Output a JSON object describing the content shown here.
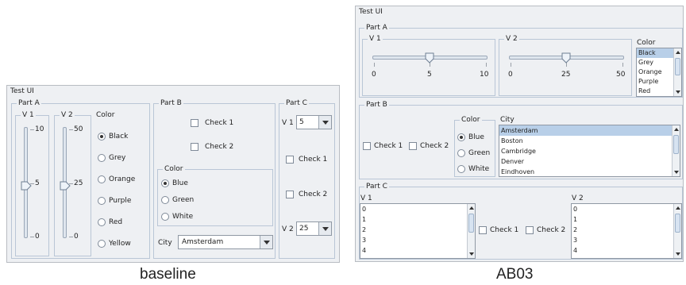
{
  "captions": {
    "left": "baseline",
    "right": "AB03"
  },
  "baseline": {
    "window_title": "Test UI",
    "part_a": {
      "title": "Part A",
      "v1": {
        "label": "V 1",
        "value": 5,
        "min": 0,
        "max": 10,
        "labels": [
          "10",
          "5",
          "0"
        ]
      },
      "v2": {
        "label": "V 2",
        "value": 25,
        "min": 0,
        "max": 50,
        "labels": [
          "50",
          "25",
          "0"
        ]
      },
      "color": {
        "title": "Color",
        "options": [
          "Black",
          "Grey",
          "Orange",
          "Purple",
          "Red",
          "Yellow"
        ],
        "selected": "Black"
      }
    },
    "part_b": {
      "title": "Part B",
      "check1": "Check 1",
      "check2": "Check 2",
      "color": {
        "title": "Color",
        "options": [
          "Blue",
          "Green",
          "White"
        ],
        "selected": "Blue"
      },
      "city_label": "City",
      "city_value": "Amsterdam"
    },
    "part_c": {
      "title": "Part C",
      "v1_label": "V 1",
      "v1_value": "5",
      "check1": "Check 1",
      "check2": "Check 2",
      "v2_label": "V 2",
      "v2_value": "25"
    }
  },
  "ab03": {
    "window_title": "Test UI",
    "part_a": {
      "title": "Part A",
      "v1": {
        "label": "V 1",
        "value": 5,
        "min": 0,
        "max": 10,
        "labels": [
          "0",
          "5",
          "10"
        ]
      },
      "v2": {
        "label": "V 2",
        "value": 25,
        "min": 0,
        "max": 50,
        "labels": [
          "0",
          "25",
          "50"
        ]
      },
      "color": {
        "title": "Color",
        "items": [
          "Black",
          "Grey",
          "Orange",
          "Purple",
          "Red"
        ],
        "selected": "Black"
      }
    },
    "part_b": {
      "title": "Part B",
      "check1": "Check 1",
      "check2": "Check 2",
      "color": {
        "title": "Color",
        "options": [
          "Blue",
          "Green",
          "White"
        ],
        "selected": "Blue"
      },
      "city": {
        "title": "City",
        "items": [
          "Amsterdam",
          "Boston",
          "Cambridge",
          "Denver",
          "Eindhoven"
        ],
        "selected": "Amsterdam"
      }
    },
    "part_c": {
      "title": "Part C",
      "v1": {
        "label": "V 1",
        "items": [
          "0",
          "1",
          "2",
          "3",
          "4"
        ]
      },
      "check1": "Check 1",
      "check2": "Check 2",
      "v2": {
        "label": "V 2",
        "items": [
          "0",
          "1",
          "2",
          "3",
          "4"
        ]
      }
    }
  }
}
